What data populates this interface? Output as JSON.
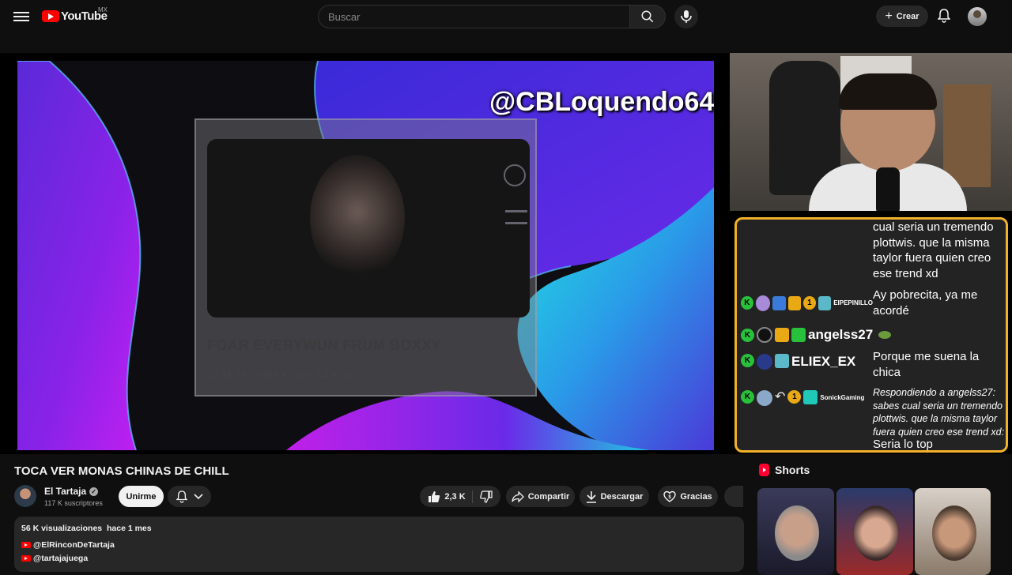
{
  "header": {
    "logo_text": "YouTube",
    "country_code": "MX",
    "search_placeholder": "Buscar",
    "create_label": "Crear"
  },
  "video": {
    "overlay_handle": "@CBLoquendo64",
    "card_title": "FOAR EVERYWUN FRUM BOXXY",
    "card_meta": "24 M de vistas • hace 14 años"
  },
  "chat": {
    "messages": [
      {
        "user": "",
        "text": "cual seria un tremendo plottwis. que la misma taylor fuera quien creo ese trend xd"
      },
      {
        "user": "EIPEPINILLO",
        "badge_number": "1",
        "text": "Ay pobrecita, ya me acordé"
      },
      {
        "user": "angelss27",
        "text": ""
      },
      {
        "user": "ELIEX_EX",
        "text": "Porque me suena la chica"
      },
      {
        "user": "SonickGaming",
        "badge_number": "1",
        "reply_prefix": "Respondiendo a angelss27: sabes cual seria un tremendo plottwis. que la misma taylor fuera quien creo ese trend xd:",
        "text": "Seria lo top"
      }
    ]
  },
  "watch": {
    "title": "TOCA VER MONAS CHINAS DE CHILL",
    "channel_name": "El Tartaja",
    "subscribers": "117 K suscriptores",
    "join_label": "Unirme",
    "likes": "2,3 K",
    "share_label": "Compartir",
    "download_label": "Descargar",
    "thanks_label": "Gracias"
  },
  "description": {
    "views": "56 K visualizaciones",
    "age": "hace 1 mes",
    "links": [
      "@ElRinconDeTartaja",
      "@tartajajuega"
    ]
  },
  "shorts": {
    "heading": "Shorts"
  },
  "colors": {
    "chat_border": "#f2b12b",
    "brand_red": "#ff0000",
    "kick_green": "#28c13b"
  }
}
